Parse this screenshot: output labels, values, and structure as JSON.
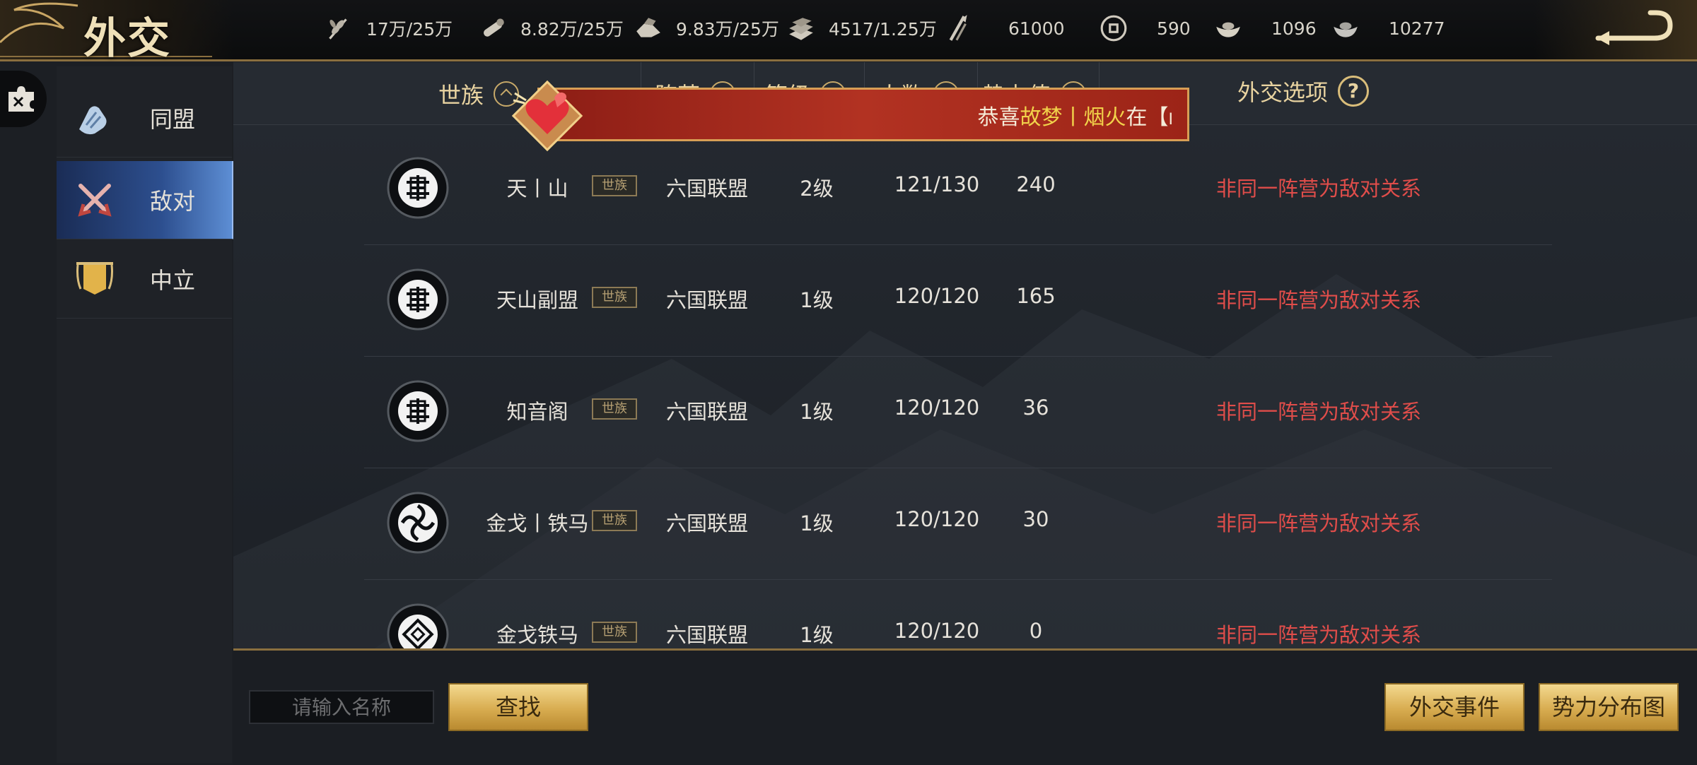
{
  "header": {
    "title": "外交",
    "resources": [
      {
        "icon": "wheat-icon",
        "value": "17万/25万"
      },
      {
        "icon": "wood-icon",
        "value": "8.82万/25万"
      },
      {
        "icon": "stone-icon",
        "value": "9.83万/25万"
      },
      {
        "icon": "iron-icon",
        "value": "4517/1.25万"
      },
      {
        "icon": "troops-icon",
        "value": "61000"
      },
      {
        "icon": "copper-coin-icon",
        "value": "590"
      },
      {
        "icon": "gold-ingot-icon",
        "value": "1096"
      },
      {
        "icon": "silver-ingot-icon",
        "value": "10277"
      }
    ]
  },
  "sidebar": {
    "items": [
      {
        "label": "同盟",
        "icon": "handshake-icon",
        "active": false
      },
      {
        "label": "敌对",
        "icon": "crossed-swords-icon",
        "active": true
      },
      {
        "label": "中立",
        "icon": "banner-icon",
        "active": false
      }
    ]
  },
  "table": {
    "headers": {
      "clan": "世族",
      "camp": "阵营",
      "level": "等级",
      "people": "人数",
      "power": "势力值",
      "options": "外交选项",
      "help": "?"
    },
    "rows": [
      {
        "name": "天丨山",
        "tag": "世族",
        "camp": "六国联盟",
        "level": "2级",
        "people": "121/130",
        "power": "240",
        "relation": "非同一阵营为敌对关系",
        "emblem": "longevity-emblem-icon"
      },
      {
        "name": "天山副盟",
        "tag": "世族",
        "camp": "六国联盟",
        "level": "1级",
        "people": "120/120",
        "power": "165",
        "relation": "非同一阵营为敌对关系",
        "emblem": "longevity-emblem-icon"
      },
      {
        "name": "知音阁",
        "tag": "世族",
        "camp": "六国联盟",
        "level": "1级",
        "people": "120/120",
        "power": "36",
        "relation": "非同一阵营为敌对关系",
        "emblem": "longevity-emblem-icon"
      },
      {
        "name": "金戈丨铁马",
        "tag": "世族",
        "camp": "六国联盟",
        "level": "1级",
        "people": "120/120",
        "power": "30",
        "relation": "非同一阵营为敌对关系",
        "emblem": "swirl-emblem-icon"
      },
      {
        "name": "金戈铁马",
        "tag": "世族",
        "camp": "六国联盟",
        "level": "1级",
        "people": "120/120",
        "power": "0",
        "relation": "非同一阵营为敌对关系",
        "emblem": "knot-emblem-icon"
      }
    ]
  },
  "bottom": {
    "search_placeholder": "请输入名称",
    "search_button": "查找",
    "events_button": "外交事件",
    "map_button": "势力分布图"
  },
  "banner": {
    "prefix": "恭喜",
    "highlight": "故梦丨烟火",
    "suffix": "在【",
    "tail": "I"
  },
  "colors": {
    "accent_gold": "#e8d3a0",
    "relation_red": "#e04d4a",
    "active_blue": "#2d4f8f",
    "banner_red": "#b23222"
  }
}
